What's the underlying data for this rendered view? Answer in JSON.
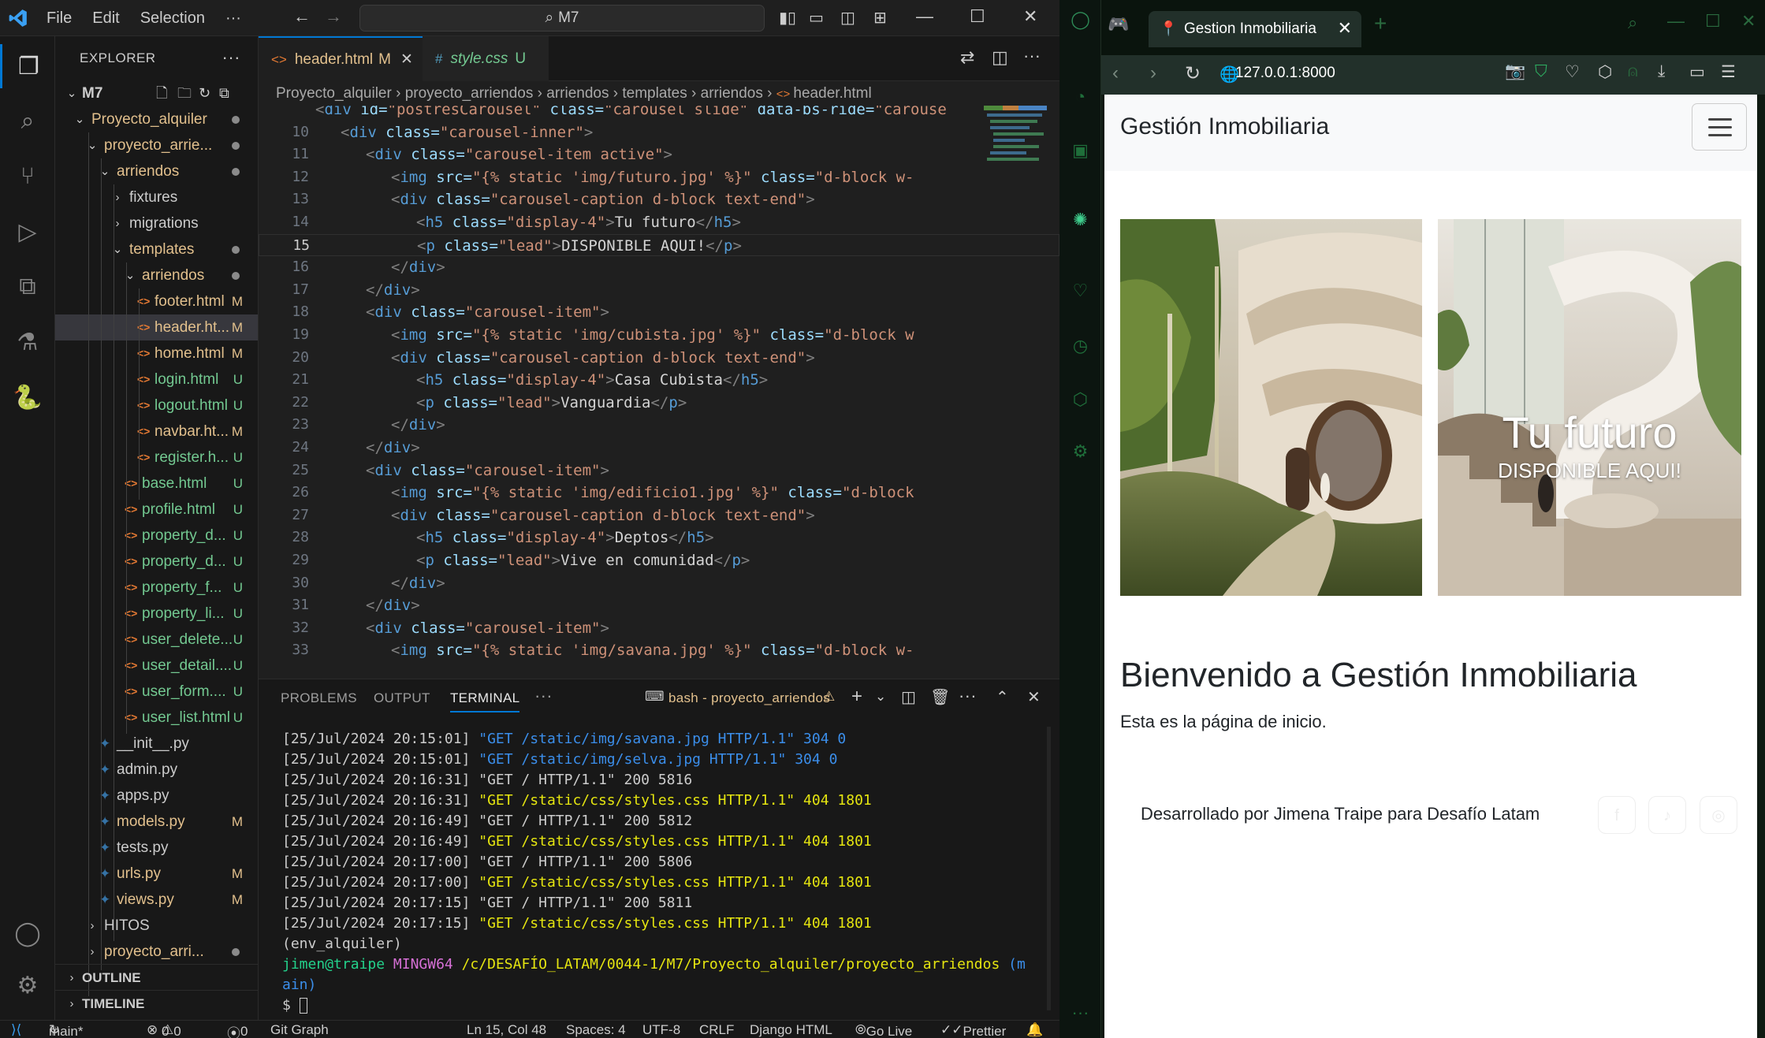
{
  "vscode": {
    "menu": [
      "File",
      "Edit",
      "Selection"
    ],
    "more": "···",
    "command_center": "M7",
    "explorer": {
      "header": "EXPLORER",
      "root": "M7",
      "tree": [
        {
          "name": "Proyecto_alquiler",
          "type": "folder",
          "status": "dot"
        },
        {
          "name": "proyecto_arrie...",
          "type": "folder",
          "status": "dot"
        },
        {
          "name": "arriendos",
          "type": "folder",
          "status": "dot"
        },
        {
          "name": "fixtures",
          "type": "folder",
          "status": ""
        },
        {
          "name": "migrations",
          "type": "folder",
          "status": ""
        },
        {
          "name": "templates",
          "type": "folder",
          "status": "dot"
        },
        {
          "name": "arriendos",
          "type": "folder",
          "status": "dot"
        },
        {
          "name": "footer.html",
          "type": "html",
          "status": "M"
        },
        {
          "name": "header.ht...",
          "type": "html",
          "status": "M"
        },
        {
          "name": "home.html",
          "type": "html",
          "status": "M"
        },
        {
          "name": "login.html",
          "type": "html",
          "status": "U"
        },
        {
          "name": "logout.html",
          "type": "html",
          "status": "U"
        },
        {
          "name": "navbar.ht...",
          "type": "html",
          "status": "M"
        },
        {
          "name": "register.h...",
          "type": "html",
          "status": "U"
        },
        {
          "name": "base.html",
          "type": "html",
          "status": "U"
        },
        {
          "name": "profile.html",
          "type": "html",
          "status": "U"
        },
        {
          "name": "property_d...",
          "type": "html",
          "status": "U"
        },
        {
          "name": "property_d...",
          "type": "html",
          "status": "U"
        },
        {
          "name": "property_f...",
          "type": "html",
          "status": "U"
        },
        {
          "name": "property_li...",
          "type": "html",
          "status": "U"
        },
        {
          "name": "user_delete...",
          "type": "html",
          "status": "U"
        },
        {
          "name": "user_detail....",
          "type": "html",
          "status": "U"
        },
        {
          "name": "user_form....",
          "type": "html",
          "status": "U"
        },
        {
          "name": "user_list.html",
          "type": "html",
          "status": "U"
        },
        {
          "name": "__init__.py",
          "type": "py",
          "status": ""
        },
        {
          "name": "admin.py",
          "type": "py",
          "status": ""
        },
        {
          "name": "apps.py",
          "type": "py",
          "status": ""
        },
        {
          "name": "models.py",
          "type": "py",
          "status": "M"
        },
        {
          "name": "tests.py",
          "type": "py",
          "status": ""
        },
        {
          "name": "urls.py",
          "type": "py",
          "status": "M"
        },
        {
          "name": "views.py",
          "type": "py",
          "status": "M"
        },
        {
          "name": "HITOS",
          "type": "folder",
          "status": ""
        },
        {
          "name": "proyecto_arri...",
          "type": "folder",
          "status": "dot"
        }
      ],
      "outline": "OUTLINE",
      "timeline": "TIMELINE"
    },
    "tabs": [
      {
        "label": "header.html",
        "badge": "M",
        "active": true
      },
      {
        "label": "style.css",
        "badge": "U",
        "active": false
      }
    ],
    "breadcrumb": [
      "Proyecto_alquiler",
      "proyecto_arriendos",
      "arriendos",
      "templates",
      "arriendos",
      "header.html"
    ],
    "code": [
      {
        "n": "",
        "i": 0,
        "t": [
          [
            "<",
            "pu"
          ],
          [
            "div ",
            "tg"
          ],
          [
            "id=",
            "at"
          ],
          [
            "\"postresCarousel\" ",
            "sv"
          ],
          [
            "class=",
            "at"
          ],
          [
            "\"carousel slide\" ",
            "sv"
          ],
          [
            "data-bs-ride=",
            "at"
          ],
          [
            "\"carouse",
            "sv"
          ]
        ]
      },
      {
        "n": "10",
        "i": 1,
        "t": [
          [
            "<",
            "pu"
          ],
          [
            "div ",
            "tg"
          ],
          [
            "class=",
            "at"
          ],
          [
            "\"carousel-inner\"",
            "sv"
          ],
          [
            ">",
            "pu"
          ]
        ]
      },
      {
        "n": "11",
        "i": 2,
        "t": [
          [
            "<",
            "pu"
          ],
          [
            "div ",
            "tg"
          ],
          [
            "class=",
            "at"
          ],
          [
            "\"carousel-item active\"",
            "sv"
          ],
          [
            ">",
            "pu"
          ]
        ]
      },
      {
        "n": "12",
        "i": 3,
        "t": [
          [
            "<",
            "pu"
          ],
          [
            "img ",
            "tg"
          ],
          [
            "src=",
            "at"
          ],
          [
            "\"{% static 'img/futuro.jpg' %}\" ",
            "sv"
          ],
          [
            "class=",
            "at"
          ],
          [
            "\"d-block w-",
            "sv"
          ]
        ]
      },
      {
        "n": "13",
        "i": 3,
        "t": [
          [
            "<",
            "pu"
          ],
          [
            "div ",
            "tg"
          ],
          [
            "class=",
            "at"
          ],
          [
            "\"carousel-caption d-block text-end\"",
            "sv"
          ],
          [
            ">",
            "pu"
          ]
        ]
      },
      {
        "n": "14",
        "i": 4,
        "t": [
          [
            "<",
            "pu"
          ],
          [
            "h5 ",
            "tg"
          ],
          [
            "class=",
            "at"
          ],
          [
            "\"display-4\"",
            "sv"
          ],
          [
            ">",
            "pu"
          ],
          [
            "Tu futuro",
            "tx"
          ],
          [
            "</",
            "pu"
          ],
          [
            "h5",
            "tg"
          ],
          [
            ">",
            "pu"
          ]
        ]
      },
      {
        "n": "15",
        "i": 4,
        "t": [
          [
            "<",
            "pu"
          ],
          [
            "p ",
            "tg"
          ],
          [
            "class=",
            "at"
          ],
          [
            "\"lead\"",
            "sv"
          ],
          [
            ">",
            "pu"
          ],
          [
            "DISPONIBLE AQUI!",
            "tx"
          ],
          [
            "</",
            "pu"
          ],
          [
            "p",
            "tg"
          ],
          [
            ">",
            "pu"
          ]
        ]
      },
      {
        "n": "16",
        "i": 3,
        "t": [
          [
            "</",
            "pu"
          ],
          [
            "div",
            "tg"
          ],
          [
            ">",
            "pu"
          ]
        ]
      },
      {
        "n": "17",
        "i": 2,
        "t": [
          [
            "</",
            "pu"
          ],
          [
            "div",
            "tg"
          ],
          [
            ">",
            "pu"
          ]
        ]
      },
      {
        "n": "18",
        "i": 2,
        "t": [
          [
            "<",
            "pu"
          ],
          [
            "div ",
            "tg"
          ],
          [
            "class=",
            "at"
          ],
          [
            "\"carousel-item\"",
            "sv"
          ],
          [
            ">",
            "pu"
          ]
        ]
      },
      {
        "n": "19",
        "i": 3,
        "t": [
          [
            "<",
            "pu"
          ],
          [
            "img ",
            "tg"
          ],
          [
            "src=",
            "at"
          ],
          [
            "\"{% static 'img/cubista.jpg' %}\" ",
            "sv"
          ],
          [
            "class=",
            "at"
          ],
          [
            "\"d-block w",
            "sv"
          ]
        ]
      },
      {
        "n": "20",
        "i": 3,
        "t": [
          [
            "<",
            "pu"
          ],
          [
            "div ",
            "tg"
          ],
          [
            "class=",
            "at"
          ],
          [
            "\"carousel-caption d-block text-end\"",
            "sv"
          ],
          [
            ">",
            "pu"
          ]
        ]
      },
      {
        "n": "21",
        "i": 4,
        "t": [
          [
            "<",
            "pu"
          ],
          [
            "h5 ",
            "tg"
          ],
          [
            "class=",
            "at"
          ],
          [
            "\"display-4\"",
            "sv"
          ],
          [
            ">",
            "pu"
          ],
          [
            "Casa Cubista",
            "tx"
          ],
          [
            "</",
            "pu"
          ],
          [
            "h5",
            "tg"
          ],
          [
            ">",
            "pu"
          ]
        ]
      },
      {
        "n": "22",
        "i": 4,
        "t": [
          [
            "<",
            "pu"
          ],
          [
            "p ",
            "tg"
          ],
          [
            "class=",
            "at"
          ],
          [
            "\"lead\"",
            "sv"
          ],
          [
            ">",
            "pu"
          ],
          [
            "Vanguardia",
            "tx"
          ],
          [
            "</",
            "pu"
          ],
          [
            "p",
            "tg"
          ],
          [
            ">",
            "pu"
          ]
        ]
      },
      {
        "n": "23",
        "i": 3,
        "t": [
          [
            "</",
            "pu"
          ],
          [
            "div",
            "tg"
          ],
          [
            ">",
            "pu"
          ]
        ]
      },
      {
        "n": "24",
        "i": 2,
        "t": [
          [
            "</",
            "pu"
          ],
          [
            "div",
            "tg"
          ],
          [
            ">",
            "pu"
          ]
        ]
      },
      {
        "n": "25",
        "i": 2,
        "t": [
          [
            "<",
            "pu"
          ],
          [
            "div ",
            "tg"
          ],
          [
            "class=",
            "at"
          ],
          [
            "\"carousel-item\"",
            "sv"
          ],
          [
            ">",
            "pu"
          ]
        ]
      },
      {
        "n": "26",
        "i": 3,
        "t": [
          [
            "<",
            "pu"
          ],
          [
            "img ",
            "tg"
          ],
          [
            "src=",
            "at"
          ],
          [
            "\"{% static 'img/edificio1.jpg' %}\" ",
            "sv"
          ],
          [
            "class=",
            "at"
          ],
          [
            "\"d-block",
            "sv"
          ]
        ]
      },
      {
        "n": "27",
        "i": 3,
        "t": [
          [
            "<",
            "pu"
          ],
          [
            "div ",
            "tg"
          ],
          [
            "class=",
            "at"
          ],
          [
            "\"carousel-caption d-block text-end\"",
            "sv"
          ],
          [
            ">",
            "pu"
          ]
        ]
      },
      {
        "n": "28",
        "i": 4,
        "t": [
          [
            "<",
            "pu"
          ],
          [
            "h5 ",
            "tg"
          ],
          [
            "class=",
            "at"
          ],
          [
            "\"display-4\"",
            "sv"
          ],
          [
            ">",
            "pu"
          ],
          [
            "Deptos",
            "tx"
          ],
          [
            "</",
            "pu"
          ],
          [
            "h5",
            "tg"
          ],
          [
            ">",
            "pu"
          ]
        ]
      },
      {
        "n": "29",
        "i": 4,
        "t": [
          [
            "<",
            "pu"
          ],
          [
            "p ",
            "tg"
          ],
          [
            "class=",
            "at"
          ],
          [
            "\"lead\"",
            "sv"
          ],
          [
            ">",
            "pu"
          ],
          [
            "Vive en comunidad",
            "tx"
          ],
          [
            "</",
            "pu"
          ],
          [
            "p",
            "tg"
          ],
          [
            ">",
            "pu"
          ]
        ]
      },
      {
        "n": "30",
        "i": 3,
        "t": [
          [
            "</",
            "pu"
          ],
          [
            "div",
            "tg"
          ],
          [
            ">",
            "pu"
          ]
        ]
      },
      {
        "n": "31",
        "i": 2,
        "t": [
          [
            "</",
            "pu"
          ],
          [
            "div",
            "tg"
          ],
          [
            ">",
            "pu"
          ]
        ]
      },
      {
        "n": "32",
        "i": 2,
        "t": [
          [
            "<",
            "pu"
          ],
          [
            "div ",
            "tg"
          ],
          [
            "class=",
            "at"
          ],
          [
            "\"carousel-item\"",
            "sv"
          ],
          [
            ">",
            "pu"
          ]
        ]
      },
      {
        "n": "33",
        "i": 3,
        "t": [
          [
            "<",
            "pu"
          ],
          [
            "img ",
            "tg"
          ],
          [
            "src=",
            "at"
          ],
          [
            "\"{% static 'img/savana.jpg' %}\" ",
            "sv"
          ],
          [
            "class=",
            "at"
          ],
          [
            "\"d-block w-",
            "sv"
          ]
        ]
      }
    ],
    "active_line": "15",
    "panel_tabs": [
      "PROBLEMS",
      "OUTPUT",
      "TERMINAL"
    ],
    "terminal_name": "bash - proyecto_arriendos",
    "terminal": [
      [
        [
          "[25/Jul/2024 20:15:01] ",
          ""
        ],
        [
          "\"GET /static/img/savana.jpg HTTP/1.1\" 304 0",
          "tb"
        ]
      ],
      [
        [
          "[25/Jul/2024 20:15:01] ",
          ""
        ],
        [
          "\"GET /static/img/selva.jpg HTTP/1.1\" 304 0",
          "tb"
        ]
      ],
      [
        [
          "[25/Jul/2024 20:16:31] \"GET / HTTP/1.1\" 200 5816",
          ""
        ]
      ],
      [
        [
          "[25/Jul/2024 20:16:31] ",
          ""
        ],
        [
          "\"GET /static/css/styles.css HTTP/1.1\" 404 1801",
          "ty"
        ]
      ],
      [
        [
          "[25/Jul/2024 20:16:49] \"GET / HTTP/1.1\" 200 5812",
          ""
        ]
      ],
      [
        [
          "[25/Jul/2024 20:16:49] ",
          ""
        ],
        [
          "\"GET /static/css/styles.css HTTP/1.1\" 404 1801",
          "ty"
        ]
      ],
      [
        [
          "[25/Jul/2024 20:17:00] \"GET / HTTP/1.1\" 200 5806",
          ""
        ]
      ],
      [
        [
          "[25/Jul/2024 20:17:00] ",
          ""
        ],
        [
          "\"GET /static/css/styles.css HTTP/1.1\" 404 1801",
          "ty"
        ]
      ],
      [
        [
          "[25/Jul/2024 20:17:15] \"GET / HTTP/1.1\" 200 5811",
          ""
        ]
      ],
      [
        [
          "[25/Jul/2024 20:17:15] ",
          ""
        ],
        [
          "\"GET /static/css/styles.css HTTP/1.1\" 404 1801",
          "ty"
        ]
      ],
      [
        [
          "(env_alquiler)",
          ""
        ]
      ],
      [
        [
          "jimen@traipe ",
          "tgr"
        ],
        [
          "MINGW64 ",
          "tm"
        ],
        [
          "/c/DESAFÍO_LATAM/0044-1/M7/Proyecto_alquiler/proyecto_arriendos ",
          "ty"
        ],
        [
          "(m",
          "tb"
        ]
      ],
      [
        [
          "ain)",
          "tb"
        ]
      ],
      [
        [
          "$ ",
          ""
        ]
      ]
    ],
    "status": {
      "branch": "main*",
      "errors": "0",
      "warnings": "0",
      "ports": "0",
      "git_graph": "Git Graph",
      "cursor": "Ln 15, Col 48",
      "spaces": "Spaces: 4",
      "encoding": "UTF-8",
      "eol": "CRLF",
      "language": "Django HTML",
      "golive": "Go Live",
      "prettier": "Prettier"
    }
  },
  "browser": {
    "tab_title": "Gestion Inmobiliaria",
    "url": "127.0.0.1:8000",
    "page": {
      "brand": "Gestión Inmobiliaria",
      "caption_title": "Tu futuro",
      "caption_text": "DISPONIBLE AQUI!",
      "welcome": "Bienvenido a Gestión Inmobiliaria",
      "subtext": "Esta es la página de inicio.",
      "footer": "Desarrollado por Jimena Traipe para Desafío Latam",
      "social_icons": [
        "facebook-icon",
        "tiktok-icon",
        "instagram-icon"
      ]
    }
  }
}
